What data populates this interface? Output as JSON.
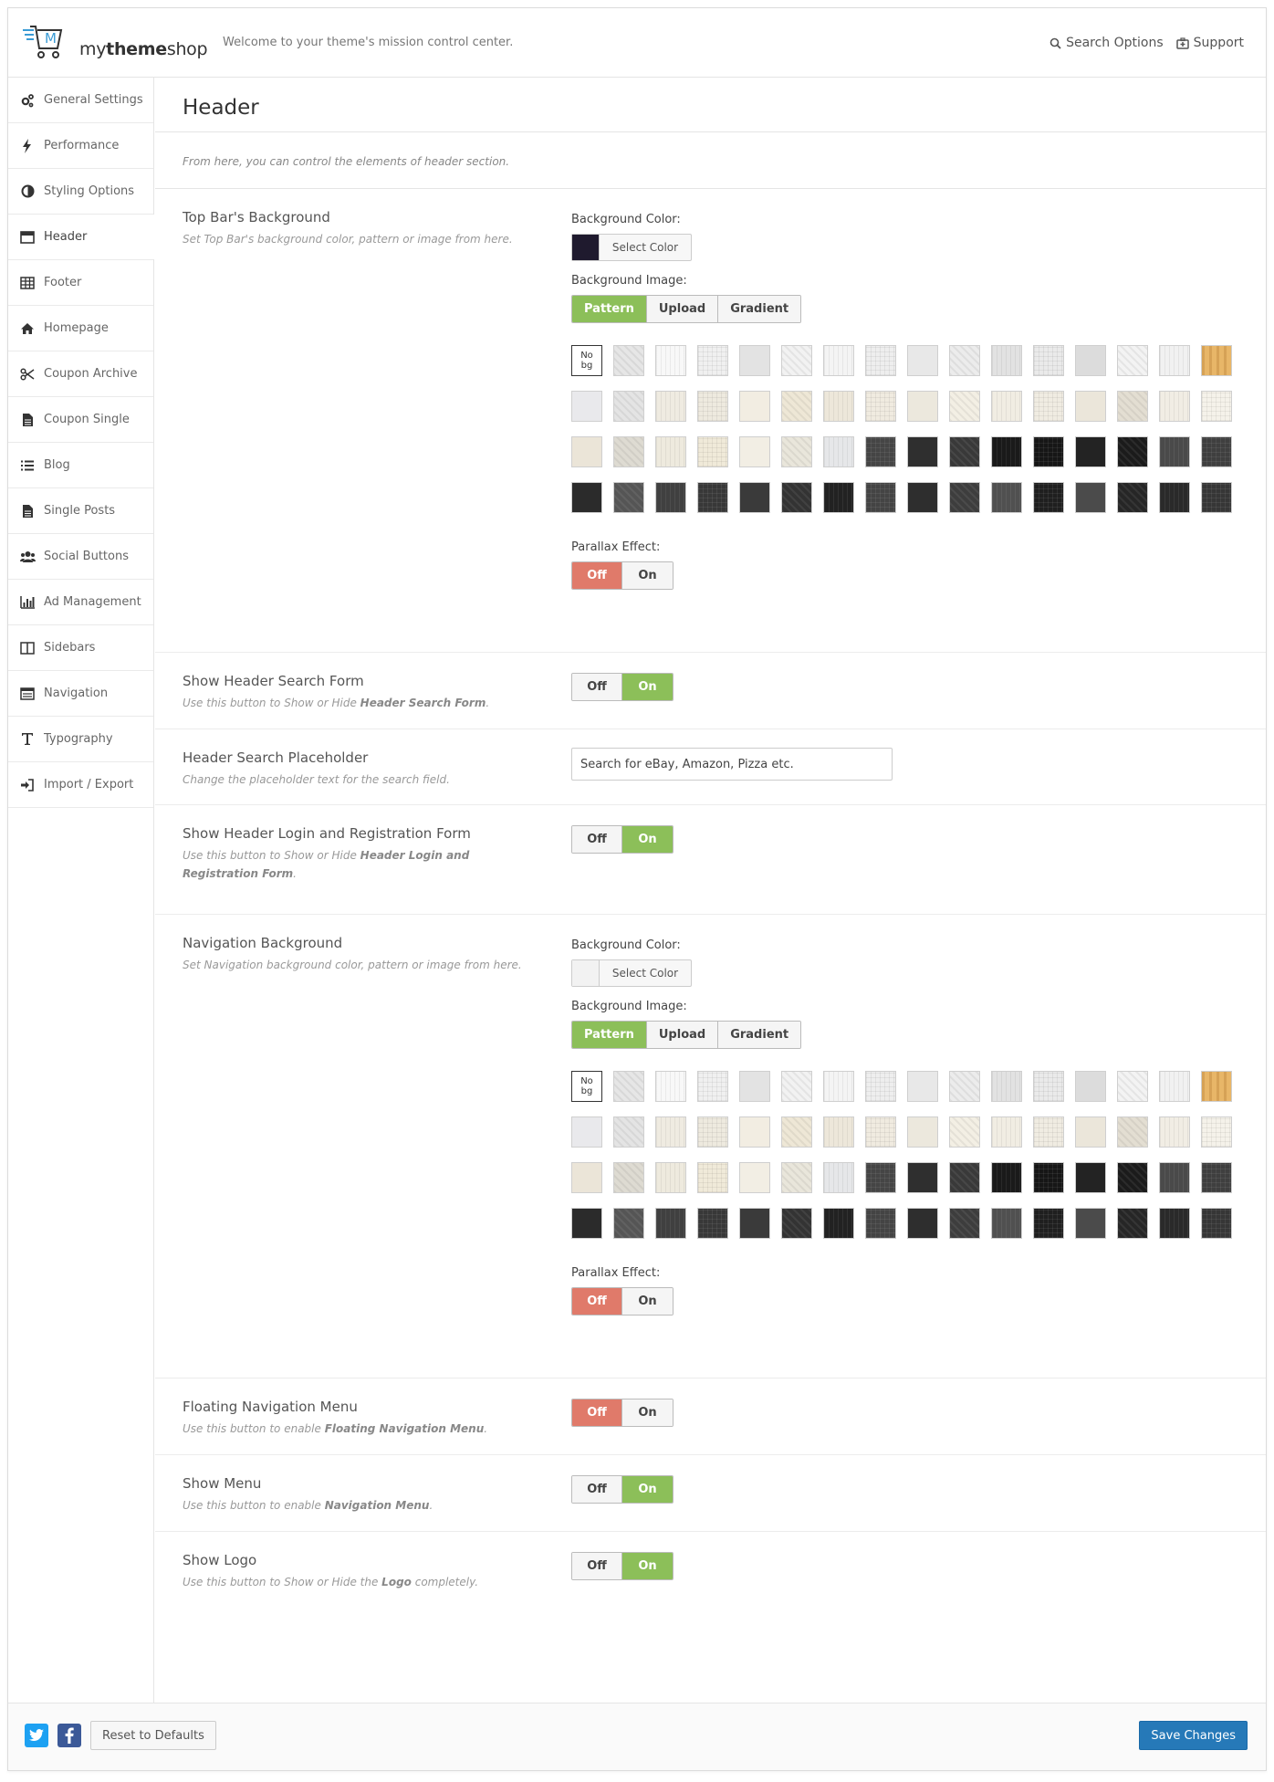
{
  "topbar": {
    "logo_letter": "M",
    "logo_prefix": "my",
    "logo_bold": "theme",
    "logo_suffix": "shop",
    "welcome": "Welcome to your theme's mission control center.",
    "search_options": "Search Options",
    "support": "Support"
  },
  "sidebar": {
    "items": [
      {
        "label": "General Settings",
        "icon": "cogs-icon"
      },
      {
        "label": "Performance",
        "icon": "bolt-icon"
      },
      {
        "label": "Styling Options",
        "icon": "contrast-icon"
      },
      {
        "label": "Header",
        "icon": "window-icon"
      },
      {
        "label": "Footer",
        "icon": "table-icon"
      },
      {
        "label": "Homepage",
        "icon": "home-icon"
      },
      {
        "label": "Coupon Archive",
        "icon": "scissors-icon"
      },
      {
        "label": "Coupon Single",
        "icon": "document-icon"
      },
      {
        "label": "Blog",
        "icon": "list-icon"
      },
      {
        "label": "Single Posts",
        "icon": "document-icon"
      },
      {
        "label": "Social Buttons",
        "icon": "users-icon"
      },
      {
        "label": "Ad Management",
        "icon": "bar-chart-icon"
      },
      {
        "label": "Sidebars",
        "icon": "columns-icon"
      },
      {
        "label": "Navigation",
        "icon": "navigation-icon"
      },
      {
        "label": "Typography",
        "icon": "text-icon"
      },
      {
        "label": "Import / Export",
        "icon": "import-icon"
      }
    ],
    "active_index": 3
  },
  "page": {
    "title": "Header",
    "description": "From here, you can control the elements of header section."
  },
  "common": {
    "bg_color_label": "Background Color:",
    "select_color": "Select Color",
    "bg_image_label": "Background Image:",
    "pattern": "Pattern",
    "upload": "Upload",
    "gradient": "Gradient",
    "parallax_label": "Parallax Effect:",
    "off": "Off",
    "on": "On",
    "no_bg": "No bg"
  },
  "sections": {
    "topbar_bg": {
      "title": "Top Bar's Background",
      "desc": "Set Top Bar's background color, pattern or image from here.",
      "color": "#1f1a2e",
      "parallax": "off"
    },
    "search_form": {
      "title": "Show Header Search Form",
      "desc_pre": "Use this button to Show or Hide ",
      "desc_bold": "Header Search Form",
      "desc_post": ".",
      "state": "on"
    },
    "search_placeholder": {
      "title": "Header Search Placeholder",
      "desc": "Change the placeholder text for the search field.",
      "value": "Search for eBay, Amazon, Pizza etc."
    },
    "login_form": {
      "title": "Show Header Login and Registration Form",
      "desc_pre": "Use this button to Show or Hide ",
      "desc_bold": "Header Login and Registration Form",
      "desc_post": ".",
      "state": "on"
    },
    "nav_bg": {
      "title": "Navigation Background",
      "desc": "Set Navigation background color, pattern or image from here.",
      "color": "#f2f2f2",
      "parallax": "off"
    },
    "floating_nav": {
      "title": "Floating Navigation Menu",
      "desc_pre": "Use this button to enable ",
      "desc_bold": "Floating Navigation Menu",
      "desc_post": ".",
      "state": "off"
    },
    "show_menu": {
      "title": "Show Menu",
      "desc_pre": "Use this button to enable ",
      "desc_bold": "Navigation Menu",
      "desc_post": ".",
      "state": "on"
    },
    "show_logo": {
      "title": "Show Logo",
      "desc_pre": "Use this button to Show or Hide the ",
      "desc_bold": "Logo",
      "desc_post": " completely.",
      "state": "on"
    }
  },
  "patterns": [
    "#ffffff",
    "#e6e6e6",
    "#f8f8f8",
    "#f0f0f0",
    "#e3e3e3",
    "#f2f2f2",
    "#f4f4f4",
    "#eeeeee",
    "#e8e8e8",
    "#ececec",
    "#e2e2e2",
    "#eaeaea",
    "#dcdcdc",
    "#f3f3f3",
    "#f1f1f1",
    "#e8b668",
    "#e9e9ec",
    "#e4e4e4",
    "#efebe1",
    "#eeeadf",
    "#f2ede2",
    "#eee7d6",
    "#ede7da",
    "#f0ebe0",
    "#ece8dd",
    "#f3efe4",
    "#f1ede3",
    "#f0ece2",
    "#ebe6da",
    "#e3ded2",
    "#f1ede4",
    "#f5f2ea",
    "#ebe5d8",
    "#dedbd2",
    "#eeeade",
    "#f0ead9",
    "#f2eee4",
    "#e9e6db",
    "#e6e7e9",
    "#454545",
    "#2f2f2f",
    "#393939",
    "#1a1a1a",
    "#161616",
    "#232323",
    "#1b1b1b",
    "#4a4a4a",
    "#3f3f3f",
    "#2b2b2b",
    "#555555",
    "#404040",
    "#383838",
    "#3a3a3a",
    "#333333",
    "#222222",
    "#444444",
    "#2e2e2e",
    "#3d3d3d",
    "#505050",
    "#1f1f1f",
    "#4b4b4b",
    "#262626",
    "#2a2a2a",
    "#363636"
  ],
  "footer": {
    "twitter": "twitter-icon",
    "facebook": "facebook-icon",
    "reset": "Reset to Defaults",
    "save": "Save Changes",
    "twitter_color": "#1da1f2",
    "facebook_color": "#3b5998"
  }
}
